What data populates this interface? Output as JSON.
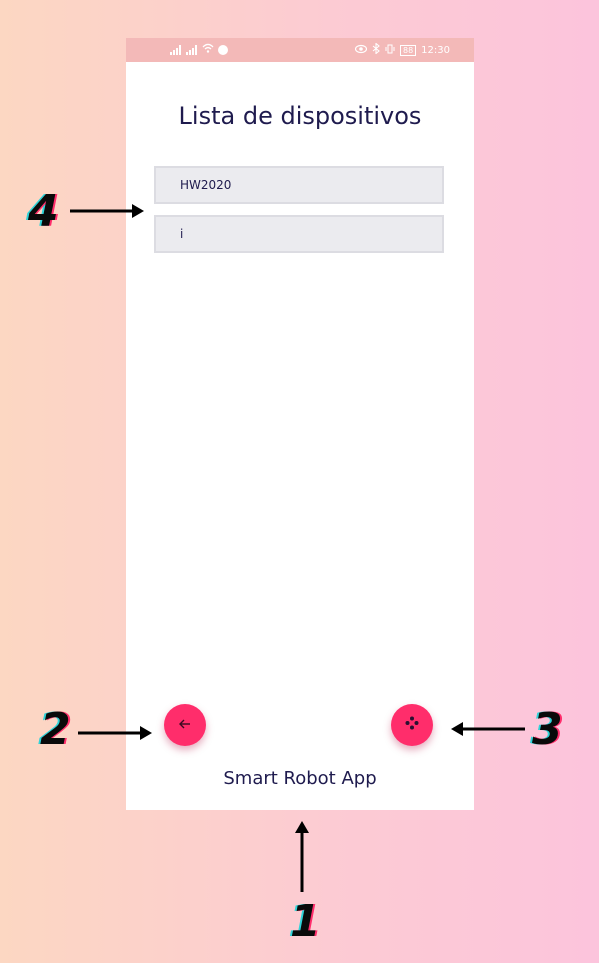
{
  "status_bar": {
    "time": "12:30",
    "battery": "88"
  },
  "screen": {
    "title": "Lista de dispositivos",
    "devices": [
      "HW2020",
      "i"
    ],
    "footer": "Smart Robot App"
  },
  "buttons": {
    "back": "back-arrow-icon",
    "controller": "gamepad-icon"
  },
  "callouts": [
    "1",
    "2",
    "3",
    "4"
  ],
  "colors": {
    "accent": "#ff2d6b",
    "status_bar": "#f3b9b8",
    "text": "#1f1b4e"
  }
}
